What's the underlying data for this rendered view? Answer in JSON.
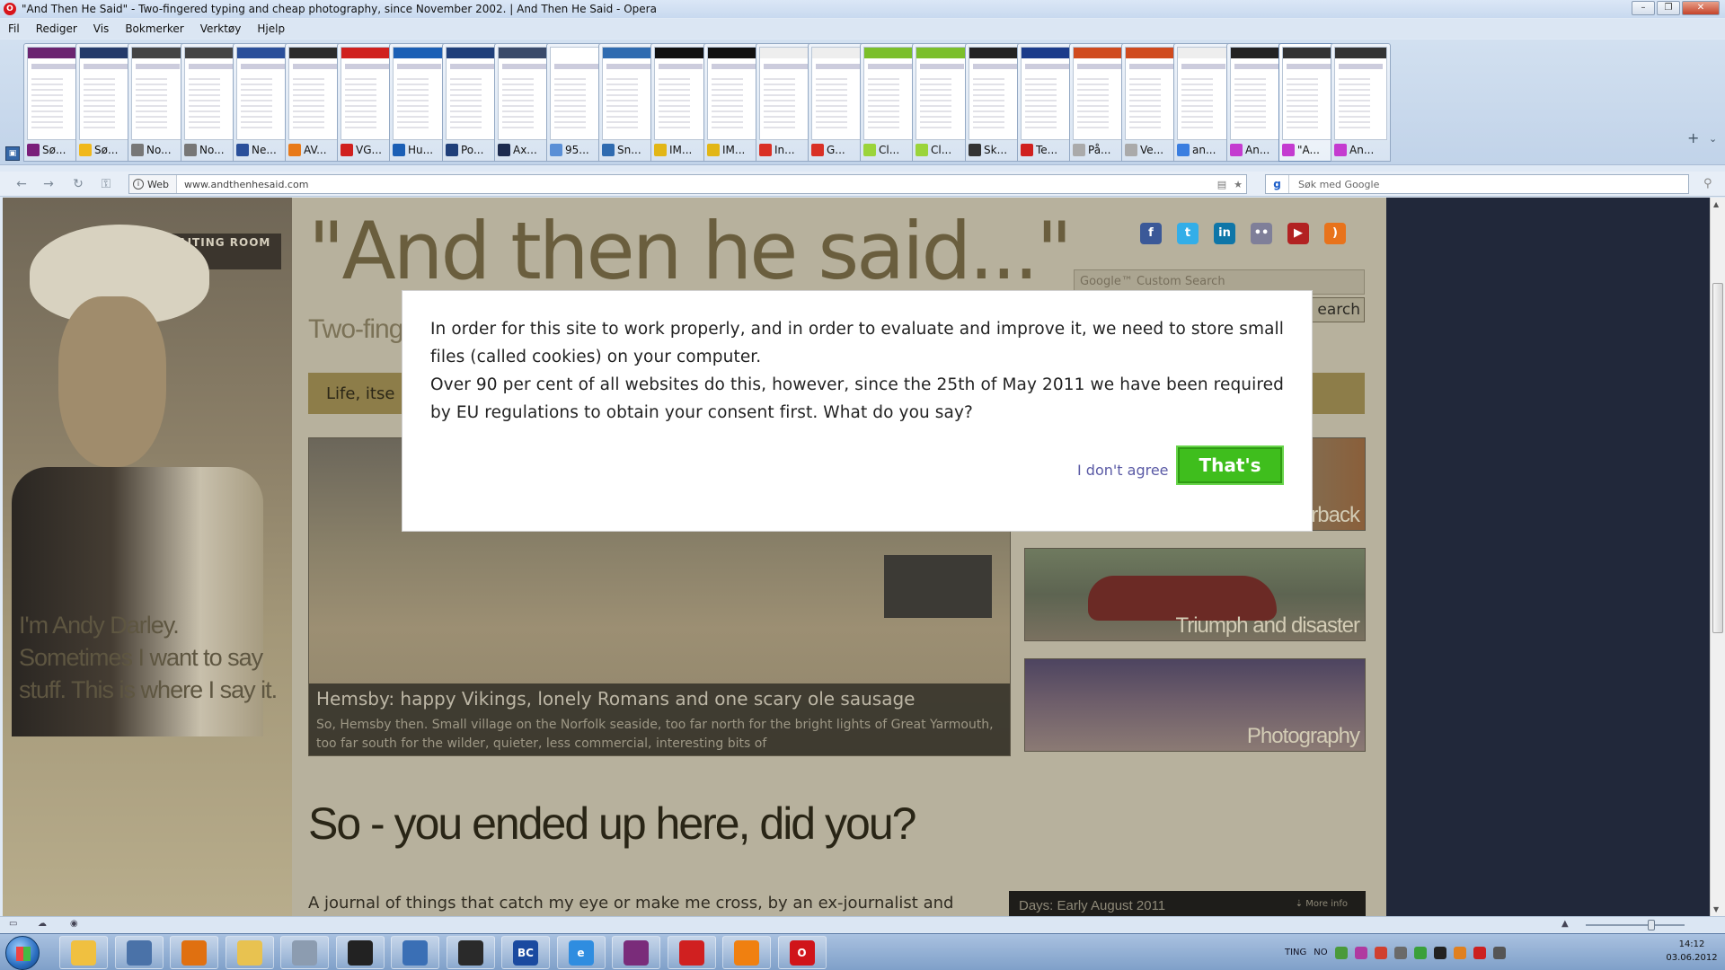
{
  "window": {
    "title": "\"And Then He Said\" - Two-fingered typing and cheap photography, since November 2002. | And Then He Said - Opera"
  },
  "menu": [
    "Fil",
    "Rediger",
    "Vis",
    "Bokmerker",
    "Verktøy",
    "Hjelp"
  ],
  "tabs": [
    {
      "label": "Sø...",
      "fav": "#7a1f7a",
      "band": "#6b2470"
    },
    {
      "label": "Sø...",
      "fav": "#f0b81b",
      "band": "#243a6a"
    },
    {
      "label": "No...",
      "fav": "#777777",
      "band": "#444444"
    },
    {
      "label": "No...",
      "fav": "#777777",
      "band": "#444444"
    },
    {
      "label": "Ne...",
      "fav": "#2a4f9a",
      "band": "#2a4f9a"
    },
    {
      "label": "AV...",
      "fav": "#e87a1a",
      "band": "#2c2c2c"
    },
    {
      "label": "VG...",
      "fav": "#d0201e",
      "band": "#d0201e"
    },
    {
      "label": "Hu...",
      "fav": "#1b5fb5",
      "band": "#1b5fb5"
    },
    {
      "label": "Po...",
      "fav": "#1f3f7a",
      "band": "#1f3f7a"
    },
    {
      "label": "Ax...",
      "fav": "#1d2b4f",
      "band": "#3a4a6a"
    },
    {
      "label": "95...",
      "fav": "#5a8fd6",
      "band": "#ffffff"
    },
    {
      "label": "Sn...",
      "fav": "#2f6bb0",
      "band": "#2f6bb0"
    },
    {
      "label": "IM...",
      "fav": "#e2b616",
      "band": "#111111"
    },
    {
      "label": "IM...",
      "fav": "#e2b616",
      "band": "#111111"
    },
    {
      "label": "In...",
      "fav": "#d93025",
      "band": "#eeeeee"
    },
    {
      "label": "G...",
      "fav": "#d93025",
      "band": "#eeeeee"
    },
    {
      "label": "Cl...",
      "fav": "#9bd43a",
      "band": "#7bbf2a"
    },
    {
      "label": "Cl...",
      "fav": "#9bd43a",
      "band": "#7bbf2a"
    },
    {
      "label": "Sk...",
      "fav": "#333333",
      "band": "#222222"
    },
    {
      "label": "Te...",
      "fav": "#d0201e",
      "band": "#1b3b8a"
    },
    {
      "label": "På...",
      "fav": "#aaaaaa",
      "band": "#d04a1e"
    },
    {
      "label": "Ve...",
      "fav": "#aaaaaa",
      "band": "#d04a1e"
    },
    {
      "label": "an...",
      "fav": "#3a7ee0",
      "band": "#eeeeee"
    },
    {
      "label": "An...",
      "fav": "#c43bd0",
      "band": "#222222"
    },
    {
      "label": "\"A...",
      "fav": "#c43bd0",
      "band": "#333333"
    },
    {
      "label": "An...",
      "fav": "#c43bd0",
      "band": "#333333"
    }
  ],
  "addressbar": {
    "security_label": "Web",
    "url": "www.andthenhesaid.com",
    "search_placeholder": "Søk med Google"
  },
  "site": {
    "title": "\"And then he said...\"",
    "subtitle": "Two-finge",
    "tagline": "Life, itse",
    "intro": "I'm Andy Darley. Sometimes I want to say stuff. This is where I say it.",
    "search_placeholder": "Google™ Custom Search",
    "search_button": "earch",
    "sign": "WAITING ROOM",
    "feature_title": "Hemsby: happy Vikings, lonely Romans and one scary ole sausage",
    "feature_text": "So, Hemsby then. Small village on the Norfolk seaside, too far north for the bright lights of Great Yarmouth, too far south for the wilder, quieter, less commercial, interesting bits of",
    "cards": [
      "erback",
      "Triumph and disaster",
      "Photography"
    ],
    "heading": "So - you ended up here, did you?",
    "journal": "A journal of things that catch my eye or make me cross, by an ex-journalist and",
    "days": "Days: Early August 2011",
    "more_info": "More info",
    "social": [
      {
        "icon": "facebook-icon",
        "glyph": "f",
        "color": "#3b5998"
      },
      {
        "icon": "twitter-icon",
        "glyph": "t",
        "color": "#33aee8"
      },
      {
        "icon": "linkedin-icon",
        "glyph": "in",
        "color": "#0e76a8"
      },
      {
        "icon": "flickr-icon",
        "glyph": "••",
        "color": "#7f7f99"
      },
      {
        "icon": "youtube-icon",
        "glyph": "▶",
        "color": "#b22222"
      },
      {
        "icon": "rss-icon",
        "glyph": ")",
        "color": "#e8731c"
      }
    ]
  },
  "cookie_dialog": {
    "paragraph1": "In order for this site to work properly, and in order to evaluate and improve it, we need to store small files (called cookies) on your computer.",
    "paragraph2": "Over 90 per cent of all websites do this, however, since the 25th of May 2011 we have been required by EU regulations to obtain your consent first. What do you say?",
    "decline_label": "I don't agree",
    "accept_label": "That's fine"
  },
  "taskbar": {
    "apps": [
      {
        "name": "paint-icon",
        "color": "#f0c040",
        "glyph": ""
      },
      {
        "name": "computer-icon",
        "color": "#4a72a8",
        "glyph": ""
      },
      {
        "name": "media-icon",
        "color": "#e07010",
        "glyph": ""
      },
      {
        "name": "explorer-icon",
        "color": "#e8c250",
        "glyph": ""
      },
      {
        "name": "calculator-icon",
        "color": "#8c9cb0",
        "glyph": ""
      },
      {
        "name": "alienware-icon",
        "color": "#222222",
        "glyph": ""
      },
      {
        "name": "network-icon",
        "color": "#3a6fb5",
        "glyph": ""
      },
      {
        "name": "steam-icon",
        "color": "#2a2a2a",
        "glyph": ""
      },
      {
        "name": "bc-icon",
        "color": "#1a4aa0",
        "glyph": "BC"
      },
      {
        "name": "ie-icon",
        "color": "#2f8de0",
        "glyph": "e"
      },
      {
        "name": "winrar-icon",
        "color": "#7a2c7a",
        "glyph": ""
      },
      {
        "name": "pdf-icon",
        "color": "#d02020",
        "glyph": ""
      },
      {
        "name": "vlc-icon",
        "color": "#f08010",
        "glyph": ""
      },
      {
        "name": "opera-icon",
        "color": "#d0141a",
        "glyph": "O"
      }
    ],
    "tray_lang1": "TING",
    "tray_lang2": "NO",
    "clock_time": "14:12",
    "clock_date": "03.06.2012"
  }
}
